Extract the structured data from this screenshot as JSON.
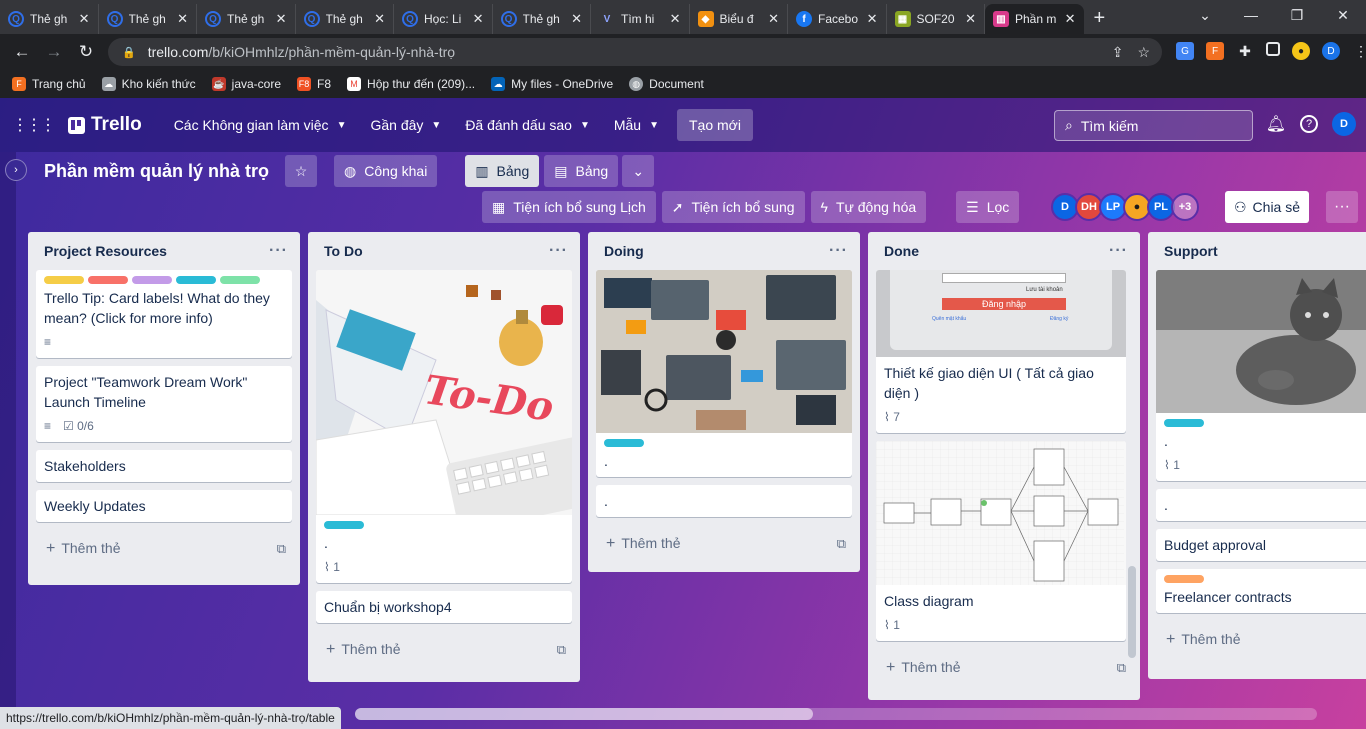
{
  "browser": {
    "tabs": [
      {
        "title": "Thẻ gh",
        "icon": "q-icon",
        "color": "#2f6ee8"
      },
      {
        "title": "Thẻ gh",
        "icon": "q-icon",
        "color": "#2f6ee8"
      },
      {
        "title": "Thẻ gh",
        "icon": "q-icon",
        "color": "#2f6ee8"
      },
      {
        "title": "Thẻ gh",
        "icon": "q-icon",
        "color": "#2f6ee8"
      },
      {
        "title": "Học: Li",
        "icon": "q-icon",
        "color": "#2f6ee8"
      },
      {
        "title": "Thẻ gh",
        "icon": "q-icon",
        "color": "#2f6ee8"
      },
      {
        "title": "Tìm hi",
        "icon": "v-icon",
        "color": "#6b7fd7"
      },
      {
        "title": "Biểu đ",
        "icon": "diagram-icon",
        "color": "#f29111"
      },
      {
        "title": "Facebo",
        "icon": "facebook-icon",
        "color": "#1877f2"
      },
      {
        "title": "SOF20",
        "icon": "sheet-icon",
        "color": "#8aa623"
      },
      {
        "title": "Phần m",
        "icon": "trello-icon",
        "color": "#d83a8b"
      }
    ],
    "url_domain": "trello.com",
    "url_path": "/b/kiOHmhlz/phần-mềm-quản-lý-nhà-trọ",
    "bookmarks": [
      {
        "label": "Trang chủ",
        "icon": "fpt-icon",
        "color": "#f37021"
      },
      {
        "label": "Kho kiến thức",
        "icon": "cloud-icon",
        "color": "#9aa0a6"
      },
      {
        "label": "java-core",
        "icon": "java-icon",
        "color": "#c0392b"
      },
      {
        "label": "F8",
        "icon": "f8-icon",
        "color": "#f05123"
      },
      {
        "label": "Hộp thư đến (209)...",
        "icon": "gmail-icon",
        "color": "#ea4335"
      },
      {
        "label": "My files - OneDrive",
        "icon": "onedrive-icon",
        "color": "#0364b8"
      },
      {
        "label": "Document",
        "icon": "globe-icon",
        "color": "#9aa0a6"
      }
    ],
    "status_url": "https://trello.com/b/kiOHmhlz/phần-mềm-quản-lý-nhà-trọ/table"
  },
  "nav": {
    "logo": "Trello",
    "menu": [
      "Các Không gian làm việc",
      "Gần đây",
      "Đã đánh dấu sao",
      "Mẫu"
    ],
    "create": "Tạo mới",
    "search_placeholder": "Tìm kiếm",
    "avatar": "D"
  },
  "board": {
    "title": "Phần mềm quản lý nhà trọ",
    "visibility": "Công khai",
    "view1": "Bảng",
    "view2": "Bảng",
    "actions": [
      "Tiện ích bổ sung Lịch",
      "Tiện ích bổ sung",
      "Tự động hóa",
      "Lọc"
    ],
    "members": [
      {
        "initials": "D",
        "color": "#0b66e4"
      },
      {
        "initials": "DH",
        "color": "#e2483d"
      },
      {
        "initials": "LP",
        "color": "#1d7afc"
      },
      {
        "initials": "",
        "color": "#f5a623"
      },
      {
        "initials": "PL",
        "color": "#0c66e4"
      }
    ],
    "more_members": "+3",
    "share": "Chia sẻ"
  },
  "lists": [
    {
      "name": "Project Resources",
      "add": "Thêm thẻ",
      "cards": [
        {
          "title": "Trello Tip: Card labels! What do they mean? (Click for more info)",
          "labels": [
            "#f5cd47",
            "#f87168",
            "#c39be8",
            "#2abbd6",
            "#7ee2a8"
          ],
          "desc": true
        },
        {
          "title": "Project \"Teamwork Dream Work\" Launch Timeline",
          "desc": true,
          "checklist": "0/6"
        },
        {
          "title": "Stakeholders"
        },
        {
          "title": "Weekly Updates"
        }
      ]
    },
    {
      "name": "To Do",
      "add": "Thêm thẻ",
      "cards": [
        {
          "cover": "todo",
          "cover_text": "To-Do",
          "labels": [
            "#2abbd6"
          ],
          "title": ".",
          "attachments": "1"
        },
        {
          "title": "Chuẩn bị workshop4"
        }
      ]
    },
    {
      "name": "Doing",
      "add": "Thêm thẻ",
      "cards": [
        {
          "cover": "laptops",
          "labels": [
            "#2abbd6"
          ],
          "title": "."
        },
        {
          "title": "."
        }
      ]
    },
    {
      "name": "Done",
      "add": "Thêm thẻ",
      "cards": [
        {
          "cover": "login",
          "cover_text": "Đăng nhập",
          "cover_small": "Lưu tài khoản",
          "cover_link1": "Quên mật khẩu",
          "cover_link2": "Đăng ký",
          "title": "Thiết kế giao diện UI ( Tất cả giao diện )",
          "attachments": "7"
        },
        {
          "cover": "diagram",
          "title": "Class diagram",
          "attachments": "1"
        }
      ]
    },
    {
      "name": "Support",
      "add": "Thêm thẻ",
      "cards": [
        {
          "cover": "cat",
          "labels": [
            "#2abbd6"
          ],
          "title": ".",
          "attachments": "1"
        },
        {
          "title": "."
        },
        {
          "title": "Budget approval"
        },
        {
          "labels": [
            "#fea362"
          ],
          "title": "Freelancer contracts"
        }
      ]
    }
  ]
}
